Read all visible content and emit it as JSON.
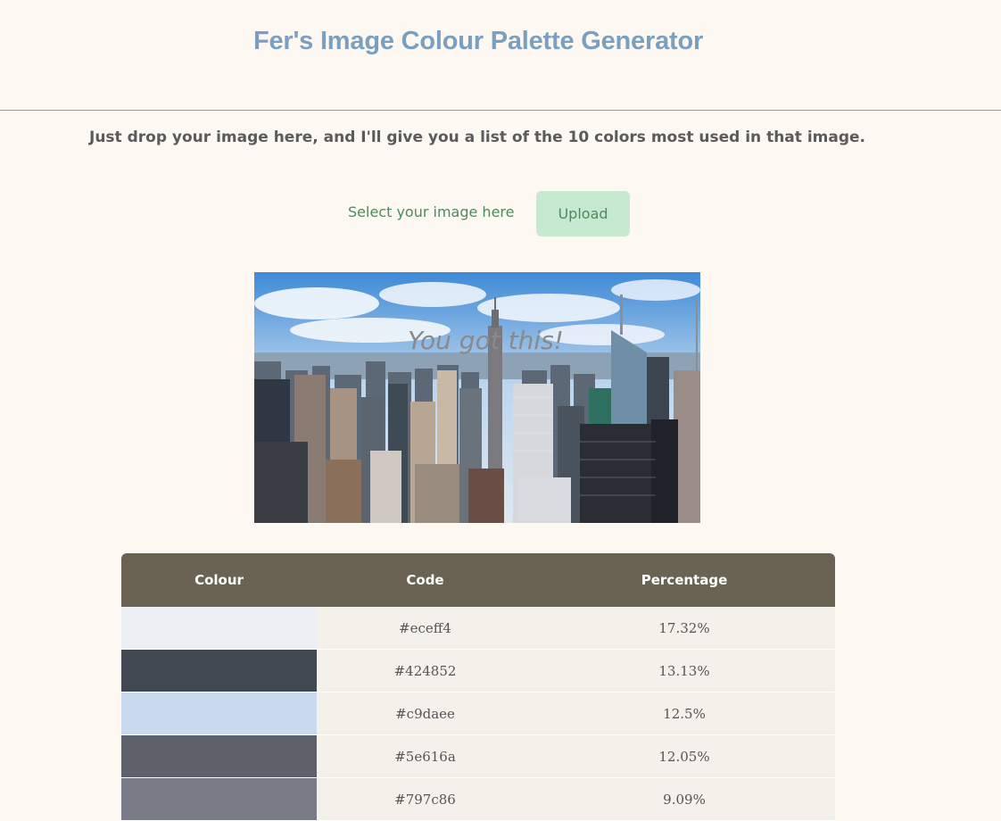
{
  "header": {
    "title": "Fer's Image Colour Palette Generator"
  },
  "intro": "Just drop your image here, and I'll give you a list of the 10 colors most used in that image.",
  "upload": {
    "select_label": "Select your image here",
    "button_label": "Upload"
  },
  "preview_image": {
    "overlay_text": "You got this!"
  },
  "table": {
    "headers": [
      "Colour",
      "Code",
      "Percentage"
    ],
    "rows": [
      {
        "code": "#eceff4",
        "percentage": "17.32%"
      },
      {
        "code": "#424852",
        "percentage": "13.13%"
      },
      {
        "code": "#c9daee",
        "percentage": "12.5%"
      },
      {
        "code": "#5e616a",
        "percentage": "12.05%"
      },
      {
        "code": "#797c86",
        "percentage": "9.09%"
      }
    ]
  }
}
